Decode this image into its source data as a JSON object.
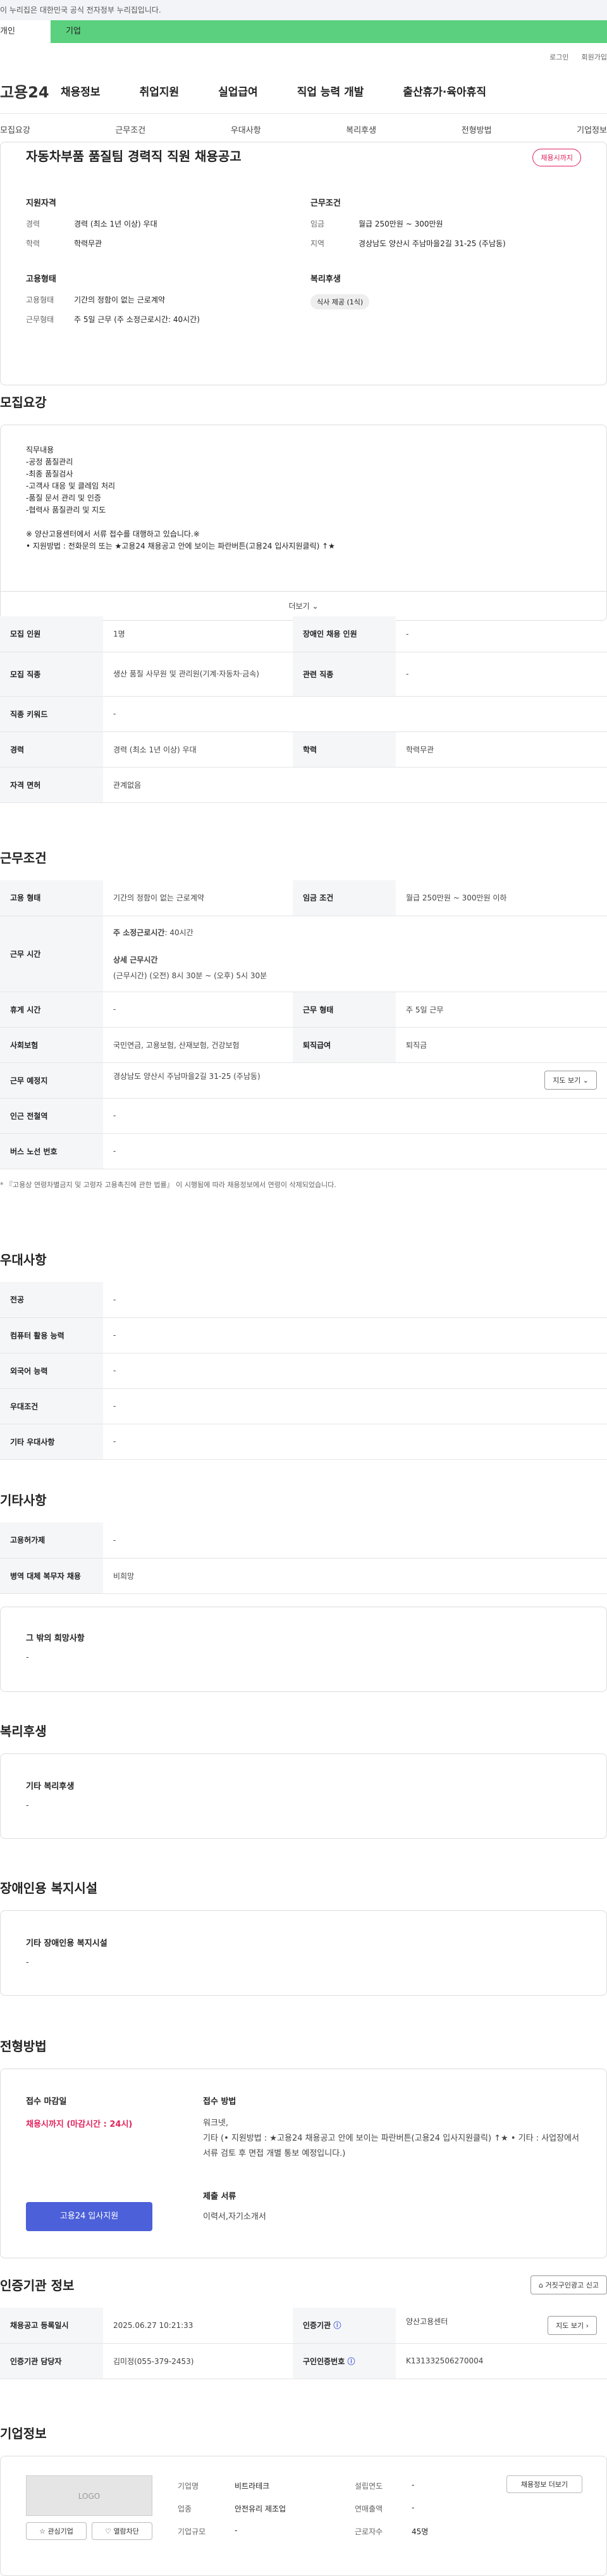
{
  "gov_banner": "이 누리집은 대한민국 공식 전자정부 누리집입니다.",
  "tabs": [
    "개인",
    "기업"
  ],
  "util": [
    "로그인",
    "회원가입"
  ],
  "logo": "고용24",
  "gnb": [
    "채용정보",
    "취업지원",
    "실업급여",
    "직업 능력 개발",
    "출산휴가·육아휴직"
  ],
  "anchors": [
    "모집요강",
    "근무조건",
    "우대사항",
    "복리후생",
    "전형방법",
    "기업정보"
  ],
  "title": "자동차부품 품질팀 경력직 직원 채용공고",
  "deadline_badge": "채용시까지",
  "summary": {
    "support_title": "지원자격",
    "career_k": "경력",
    "career_v": "경력 (최소 1년 이상) 우대",
    "edu_k": "학력",
    "edu_v": "학력무관",
    "cond_title": "근무조건",
    "wage_k": "임금",
    "wage_v": "월급 250만원 ~ 300만원",
    "area_k": "지역",
    "area_v": "경상남도 양산시 주남마을2길 31-25 (주남동)",
    "emp_title": "고용형태",
    "type_k": "고용형태",
    "type_v": "기간의 정함이 없는 근로계약",
    "form_k": "근무형태",
    "form_v": "주 5일 근무 (주 소정근로시간: 40시간)",
    "welfare_title": "복리후생",
    "welfare_chip": "식사 제공 (1식)"
  },
  "recruit_title": "모집요강",
  "job_desc": {
    "label": "직무내용",
    "text": "직무내용\n-공정 품질관리\n-최종 품질검사\n-고객사 대응 및 클레임 처리\n-품질 문서 관리 및 인증\n-협력사 품질관리 및 지도\n\n※ 양산고용센터에서 서류 접수를 대행하고 있습니다.※\n• 지원방법 : 전화문의 또는 ★고용24 채용공고 안에 보이는 파란버튼(고용24 입사지원클릭) ↑★",
    "more": "더보기"
  },
  "recruit_table": [
    [
      "모집 인원",
      "1명",
      "장애인 채용 인원",
      "-"
    ],
    [
      "모집 직종",
      "생산 품질 사무원 및 관리원(기계·자동차·금속)",
      "관련 직종",
      "-"
    ],
    [
      "직종 키워드",
      "-"
    ],
    [
      "경력",
      "경력 (최소 1년 이상) 우대",
      "학력",
      "학력무관"
    ],
    [
      "자격 면허",
      "관계없음"
    ]
  ],
  "cond_section": {
    "title": "근무조건",
    "emp_type_k": "고용 형태",
    "emp_type_v": "기간의 정함이 없는 근로계약",
    "wage_k": "임금 조건",
    "wage_v": "월급 250만원 ~ 300만원 이하",
    "hours_k": "근무 시간",
    "hours_weekly_label": "주 소정근로시간",
    "hours_weekly_v": ": 40시간",
    "hours_detail_label": "상세 근무시간",
    "hours_detail_v": "(근무시간) (오전) 8시 30분 ~ (오후) 5시 30분",
    "rest_k": "휴게 시간",
    "rest_v": "-",
    "form_k": "근무 형태",
    "form_v": "주 5일 근무",
    "ins_k": "사회보험",
    "ins_v": "국민연금, 고용보험, 산재보험, 건강보험",
    "retire_k": "퇴직급여",
    "retire_v": "퇴직금",
    "place_k": "근무 예정지",
    "place_v": "경상남도 양산시 주남마을2길 31-25 (주남동)",
    "map_btn": "지도 보기",
    "subway_k": "인근 전철역",
    "subway_v": "-",
    "bus_k": "버스 노선 번호",
    "bus_v": "-",
    "note": "* 『고용상 연령차별금지 및 고령자 고용촉진에 관한 법률』 이 시행됨에 따라 채용정보에서 연령이 삭제되었습니다."
  },
  "pref": {
    "title": "우대사항",
    "rows": [
      [
        "전공",
        "-"
      ],
      [
        "컴퓨터 활용 능력",
        "-"
      ],
      [
        "외국어 능력",
        "-"
      ],
      [
        "우대조건",
        "-"
      ],
      [
        "기타 우대사항",
        "-"
      ]
    ]
  },
  "etc": {
    "title": "기타사항",
    "rows": [
      [
        "고용허가제",
        "-"
      ],
      [
        "병역 대체 복무자 채용",
        "비희망"
      ]
    ],
    "other_label": "그 밖의 희망사항",
    "other_v": "-"
  },
  "welfare": {
    "title": "복리후생",
    "label": "기타 복리후생",
    "v": "-"
  },
  "disability": {
    "title": "장애인용 복지시설",
    "label": "기타 장애인용 복지시설",
    "v": "-"
  },
  "screening": {
    "title": "전형방법",
    "deadline_label": "접수 마감일",
    "deadline_v": "채용시까지 (마감시간 : 24시)",
    "apply_btn": "고용24 입사지원",
    "method_label": "접수 방법",
    "method_v": "워크넷,\n기타 (• 지원방법 : ★고용24 채용공고 안에 보이는 파란버튼(고용24 입사지원클릭) ↑★ • 기타 : 사업장에서 서류 검토 후 면접 개별 통보 예정입니다.)",
    "docs_label": "제출 서류",
    "docs_v": "이력서,자기소개서"
  },
  "cert": {
    "title": "인증기관 정보",
    "report_btn": "거짓구인광고 신고",
    "reg_k": "채용공고 등록일시",
    "reg_v": "2025.06.27 10:21:33",
    "org_k": "인증기관",
    "org_v": "양산고용센터",
    "map_btn": "지도 보기",
    "mgr_k": "인증기관 담당자",
    "mgr_v": "김미정(055-379-2453)",
    "no_k": "구인인증번호",
    "no_v": "K131332506270004"
  },
  "company": {
    "title": "기업정보",
    "logo": "LOGO",
    "fav_btn": "관심기업",
    "block_btn": "열람차단",
    "name_k": "기업명",
    "name_v": "비트라테크",
    "year_k": "설립연도",
    "year_v": "-",
    "ind_k": "업종",
    "ind_v": "안전유리 제조업",
    "sales_k": "연매출액",
    "sales_v": "-",
    "size_k": "기업규모",
    "size_v": "-",
    "emp_k": "근로자수",
    "emp_v": "45명",
    "jobs_btn": "채용정보 더보기"
  }
}
